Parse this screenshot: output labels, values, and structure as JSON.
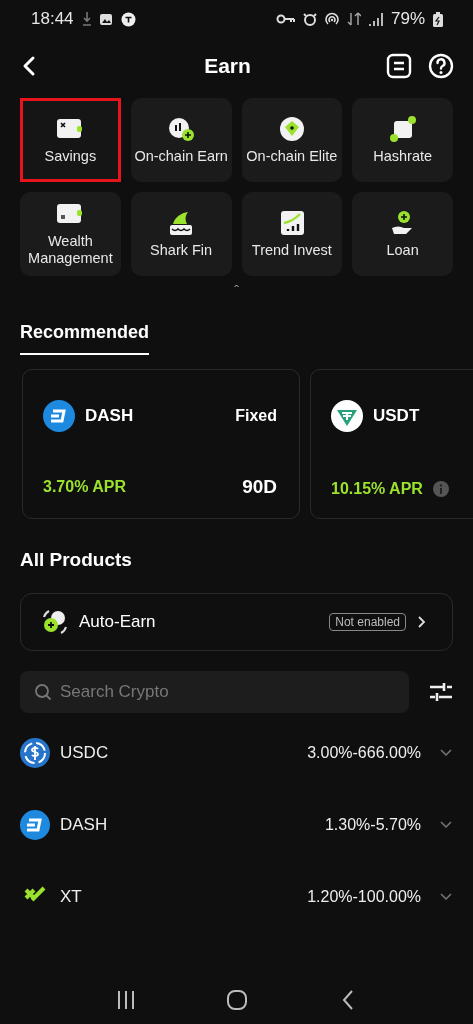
{
  "status_bar": {
    "time": "18:44",
    "battery": "79%"
  },
  "header": {
    "title": "Earn"
  },
  "products": [
    {
      "label": "Savings",
      "highlighted": true
    },
    {
      "label": "On-chain Earn",
      "highlighted": false
    },
    {
      "label": "On-chain Elite",
      "highlighted": false
    },
    {
      "label": "Hashrate",
      "highlighted": false
    },
    {
      "label": "Wealth Management",
      "highlighted": false
    },
    {
      "label": "Shark Fin",
      "highlighted": false
    },
    {
      "label": "Trend Invest",
      "highlighted": false
    },
    {
      "label": "Loan",
      "highlighted": false
    }
  ],
  "collapse": "ˆ",
  "tabs": [
    {
      "label": "Recommended",
      "selected": true
    }
  ],
  "recommended": [
    {
      "coin": "DASH",
      "type": "Fixed",
      "apr": "3.70% APR",
      "term": "90D",
      "info": false
    },
    {
      "coin": "USDT",
      "apr": "10.15% APR",
      "info": true
    }
  ],
  "all_products": {
    "title": "All Products",
    "auto_earn": {
      "label": "Auto-Earn",
      "status": "Not enabled"
    },
    "search": {
      "placeholder": "Search Crypto"
    },
    "rows": [
      {
        "coin": "USDC",
        "range": "3.00%-666.00%"
      },
      {
        "coin": "DASH",
        "range": "1.30%-5.70%"
      },
      {
        "coin": "XT",
        "range": "1.20%-100.00%"
      }
    ]
  }
}
